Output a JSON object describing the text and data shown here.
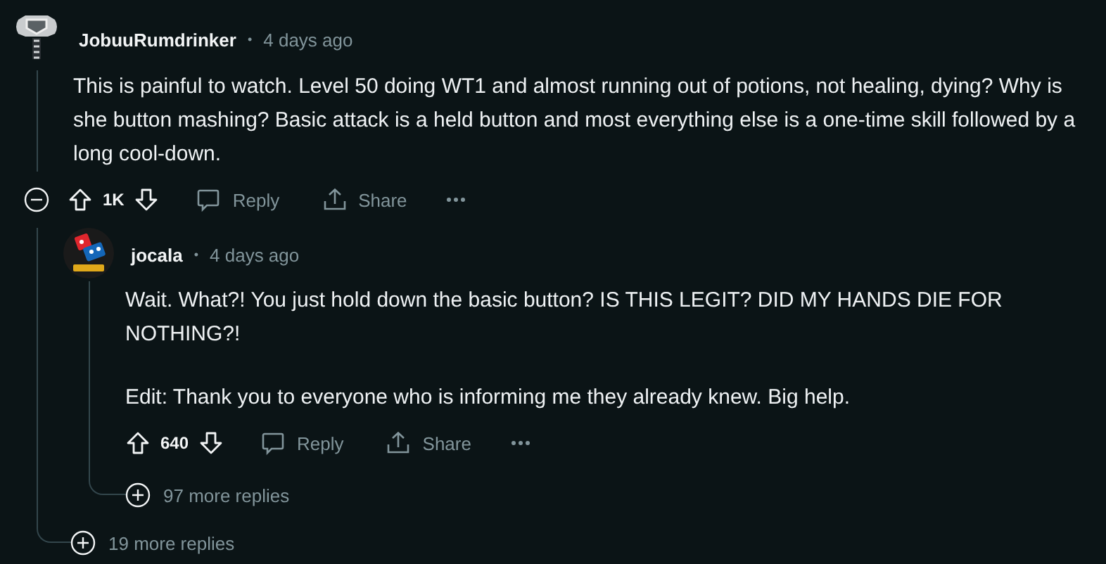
{
  "comment": {
    "author": "JobuuRumdrinker",
    "separator": "•",
    "time": "4 days ago",
    "expanded": true,
    "body": [
      "This is painful to watch. Level 50 doing WT1 and almost running out of potions, not healing, dying? Why is she button mashing? Basic attack is a held button and most everything else is a one-time skill followed by a long cool-down."
    ],
    "votes": "1K",
    "reply": "Reply",
    "share": "Share",
    "replies": [
      {
        "author": "jocala",
        "separator": "•",
        "time": "4 days ago",
        "body": [
          "Wait. What?! You just hold down the basic button? IS THIS LEGIT? DID MY HANDS DIE FOR NOTHING?!",
          "Edit: Thank you to everyone who is informing me they already knew. Big help."
        ],
        "votes": "640",
        "reply": "Reply",
        "share": "Share",
        "more_replies": "97 more replies"
      }
    ],
    "more_replies": "19 more replies"
  }
}
